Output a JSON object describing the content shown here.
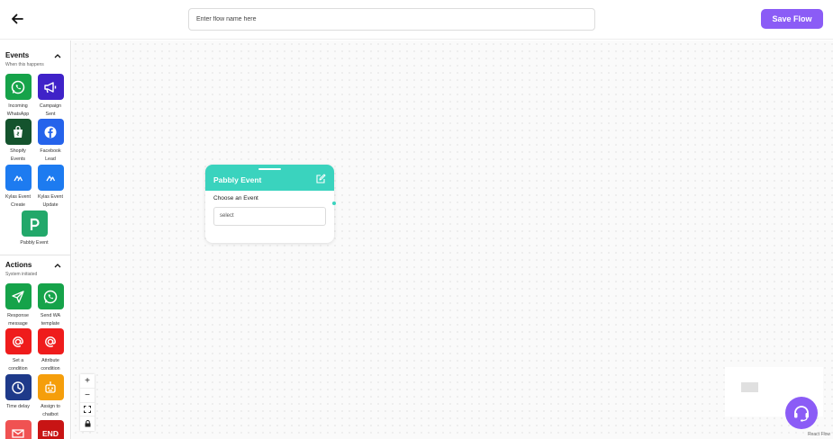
{
  "header": {
    "flow_name_placeholder": "Enter flow name here",
    "save_label": "Save Flow",
    "accent_color": "#8b5cf6"
  },
  "sidebar": {
    "events": {
      "title": "Events",
      "subtitle": "When this happens",
      "items": [
        {
          "label": "Incoming WhatsApp",
          "icon": "whatsapp-icon",
          "color": "#16a34a"
        },
        {
          "label": "Campaign Sent",
          "icon": "megaphone-icon",
          "color": "#3f22c8"
        },
        {
          "label": "Shopify Events",
          "icon": "shopify-bag-icon",
          "color": "#14532d"
        },
        {
          "label": "Facebook Lead",
          "icon": "facebook-icon",
          "color": "#2563eb"
        },
        {
          "label": "Kylas Event Create",
          "icon": "kylas-icon",
          "color": "#1d7bf0"
        },
        {
          "label": "Kylas Event Update",
          "icon": "kylas-icon",
          "color": "#1d7bf0"
        },
        {
          "label": "Pabbly Event",
          "icon": "pabbly-icon",
          "color": "#22a86a"
        }
      ]
    },
    "actions": {
      "title": "Actions",
      "subtitle": "System initiated",
      "items": [
        {
          "label": "Response message",
          "icon": "send-icon",
          "color": "#16a34a"
        },
        {
          "label": "Send WA template",
          "icon": "whatsapp-icon",
          "color": "#16a34a"
        },
        {
          "label": "Set a condition",
          "icon": "at-sign-icon",
          "color": "#ef1c1c"
        },
        {
          "label": "Attribute condition",
          "icon": "at-sign-icon",
          "color": "#ef1c1c"
        },
        {
          "label": "Time delay",
          "icon": "clock-icon",
          "color": "#1e3a8a"
        },
        {
          "label": "Assign to chatbot",
          "icon": "robot-icon",
          "color": "#f59e0b"
        },
        {
          "label": "",
          "icon": "mail-icon",
          "color": "#f05252"
        },
        {
          "label": "END",
          "icon": "end-icon",
          "color": "#c81414"
        }
      ]
    }
  },
  "node": {
    "title": "Pabbly Event",
    "field_label": "Choose an Event",
    "select_value": "select",
    "header_color": "#3ad3be"
  },
  "controls": {
    "zoom_in": "+",
    "zoom_out": "−"
  },
  "attribution": "React Flow"
}
